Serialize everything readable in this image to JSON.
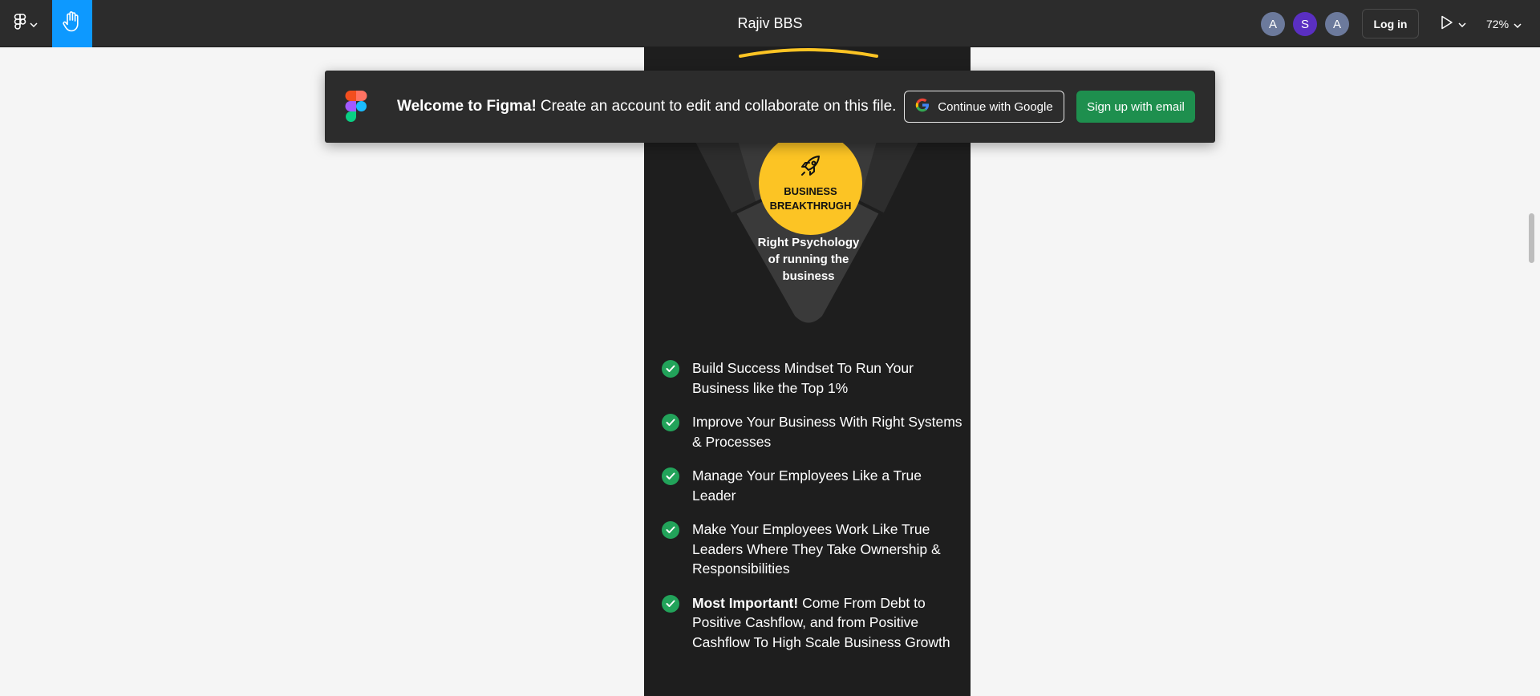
{
  "toolbar": {
    "menu_icon": "figma-menu-icon",
    "tool_icon": "hand-tool-icon",
    "title": "Rajiv BBS",
    "avatars": [
      {
        "initial": "A",
        "color": "#6c7a9c"
      },
      {
        "initial": "S",
        "color": "#5a2fc2"
      },
      {
        "initial": "A",
        "color": "#6c7a9c"
      }
    ],
    "login_label": "Log in",
    "present_icon": "play-icon",
    "zoom_label": "72%"
  },
  "banner": {
    "logo_icon": "figma-logo-icon",
    "welcome_bold": "Welcome to Figma!",
    "welcome_text": "Create an account to edit and collaborate on this file.",
    "google_icon": "google-g-icon",
    "google_label": "Continue with Google",
    "email_label": "Sign up with email"
  },
  "canvas": {
    "badge_icon": "rocket-icon",
    "badge_line1": "BUSINESS",
    "badge_line2": "BREAKTHRUGH",
    "psych_line1": "Right Psychology",
    "psych_line2": "of running the",
    "psych_line3": "business",
    "bullets": [
      {
        "bold": "",
        "text": "Build Success Mindset To Run Your Business like the Top 1%"
      },
      {
        "bold": "",
        "text": "Improve Your Business With Right Systems & Processes"
      },
      {
        "bold": "",
        "text": "Manage Your Employees Like a True Leader"
      },
      {
        "bold": "",
        "text": "Make Your Employees Work Like True Leaders Where They Take Ownership & Responsibilities"
      },
      {
        "bold": "Most Important!",
        "text": "Come From Debt to Positive Cashflow, and from Positive Cashflow To High Scale Business Growth"
      }
    ],
    "colors": {
      "accent_yellow": "#fcc424",
      "check_green": "#22a35a",
      "frame_bg": "#1e1e1e"
    }
  }
}
